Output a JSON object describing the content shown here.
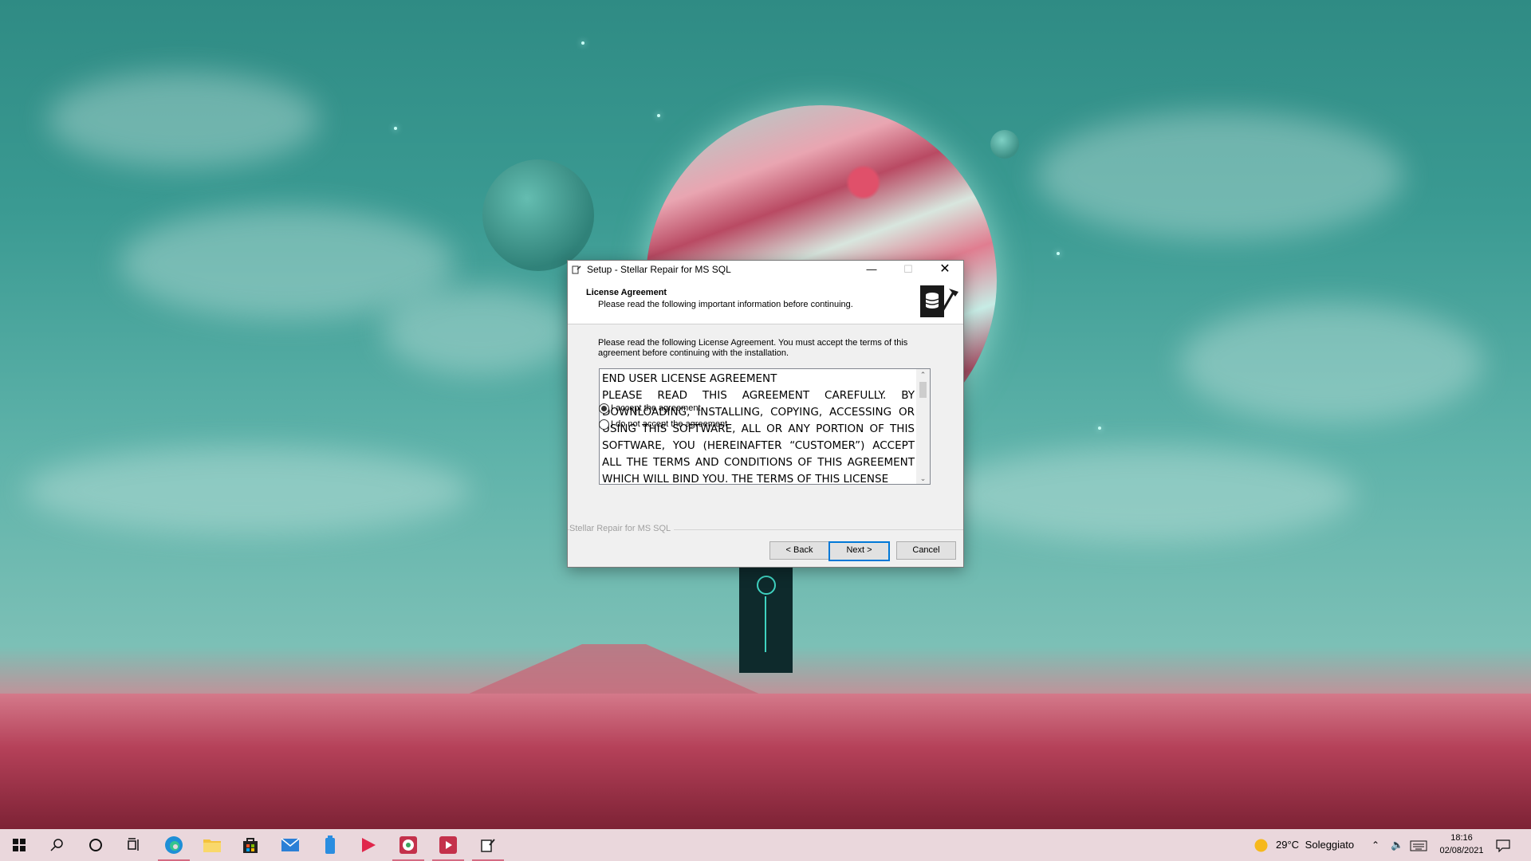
{
  "window": {
    "title": "Setup - Stellar Repair for MS SQL",
    "minimize_icon": "minimize-icon",
    "maximize_icon": "maximize-icon",
    "close_icon": "close-icon"
  },
  "header": {
    "heading": "License Agreement",
    "subheading": "Please read the following important information before continuing."
  },
  "intro": "Please read the following License Agreement. You must accept the terms of this agreement before continuing with the installation.",
  "license": {
    "title": "END USER LICENSE AGREEMENT",
    "body": "PLEASE READ THIS AGREEMENT CAREFULLY. BY DOWNLOADING, INSTALLING, COPYING, ACCESSING OR USING THIS SOFTWARE, ALL OR ANY PORTION OF THIS SOFTWARE, YOU (HEREINAFTER “CUSTOMER”) ACCEPT ALL THE TERMS AND CONDITIONS OF THIS AGREEMENT WHICH WILL BIND YOU. THE TERMS OF THIS LICENSE"
  },
  "options": {
    "accept": "I accept the agreement",
    "decline": "I do not accept the agreement",
    "selected": "accept"
  },
  "footer_label": "Stellar Repair for MS SQL",
  "buttons": {
    "back": "< Back",
    "next": "Next >",
    "cancel": "Cancel"
  },
  "taskbar": {
    "weather_temp": "29°C",
    "weather_desc": "Soleggiato",
    "time": "18:16",
    "date": "02/08/2021",
    "colors": {
      "taskbar_bg": "#ead7dc",
      "accent": "#0078d7"
    }
  }
}
